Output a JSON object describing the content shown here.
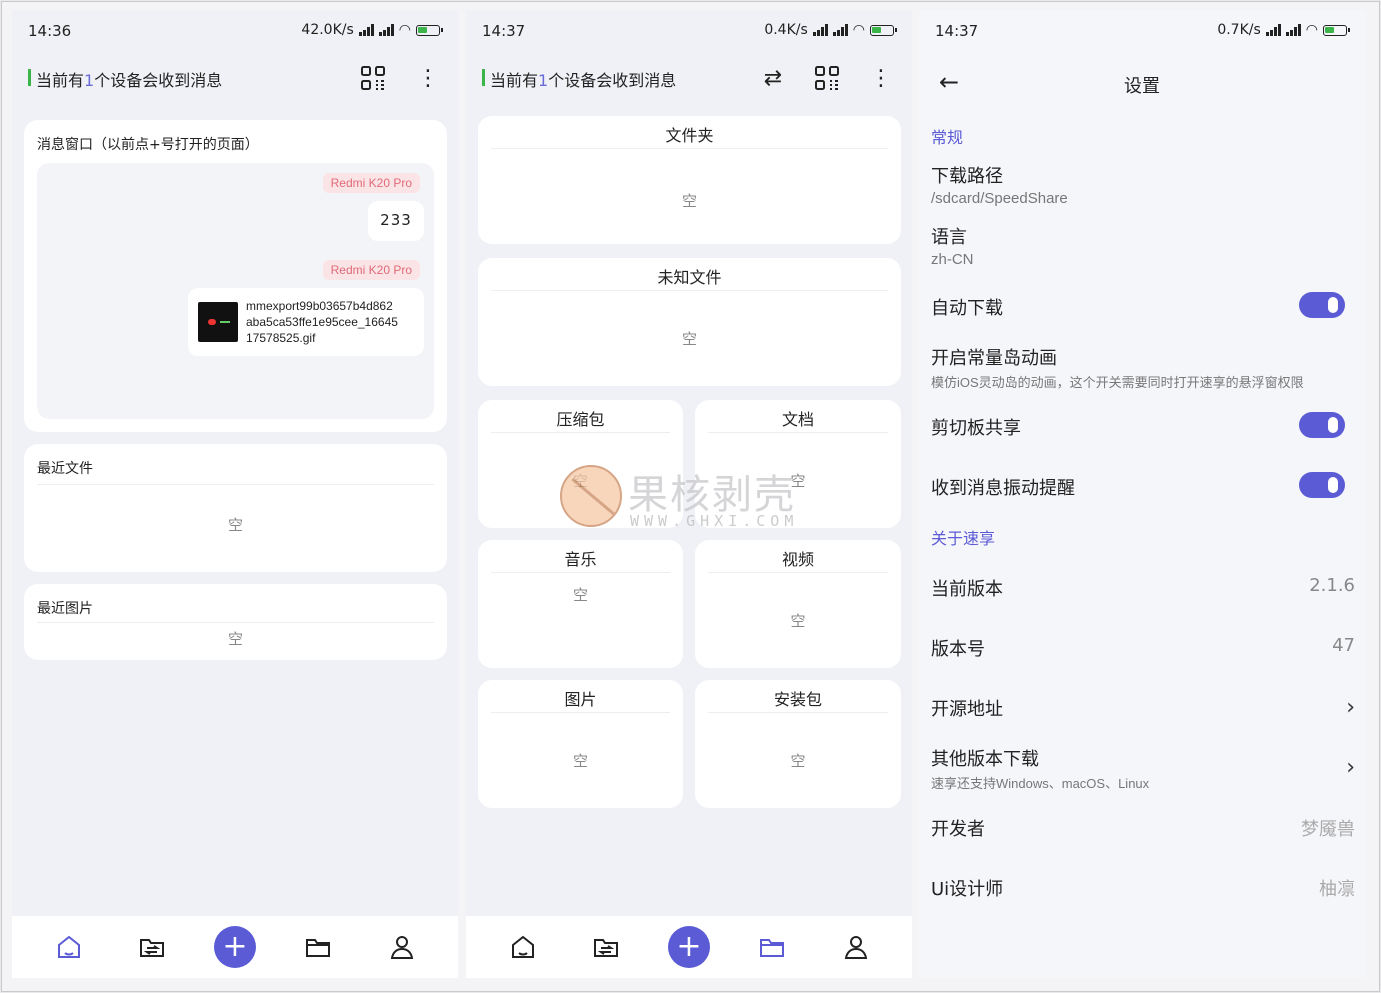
{
  "panel1": {
    "status": {
      "time": "14:36",
      "speed": "42.0K/s"
    },
    "header": {
      "prefix": "当前有",
      "num": "1",
      "suffix": "个设备会收到消息"
    },
    "msg_card": {
      "title": "消息窗口（以前点+号打开的页面）",
      "messages": [
        {
          "device": "Redmi K20 Pro",
          "text": "233"
        },
        {
          "device": "Redmi K20 Pro",
          "file_lines": [
            "mmexport99b03657b4d862",
            "aba5ca53ffe1e95cee_16645",
            "17578525.gif"
          ]
        }
      ]
    },
    "recent_files": {
      "title": "最近文件",
      "empty": "空"
    },
    "recent_images": {
      "title": "最近图片",
      "empty": "空"
    }
  },
  "panel2": {
    "status": {
      "time": "14:37",
      "speed": "0.4K/s"
    },
    "header": {
      "prefix": "当前有",
      "num": "1",
      "suffix": "个设备会收到消息"
    },
    "cards": {
      "folder": {
        "title": "文件夹",
        "empty": "空"
      },
      "unknown": {
        "title": "未知文件",
        "empty": "空"
      },
      "zip": {
        "title": "压缩包",
        "empty": "空"
      },
      "doc": {
        "title": "文档",
        "empty": "空"
      },
      "music": {
        "title": "音乐",
        "empty": "空"
      },
      "video": {
        "title": "视频",
        "empty": "空"
      },
      "image": {
        "title": "图片",
        "empty": "空"
      },
      "apk": {
        "title": "安装包",
        "empty": "空"
      }
    }
  },
  "panel3": {
    "status": {
      "time": "14:37",
      "speed": "0.7K/s"
    },
    "title": "设置",
    "section_general": "常规",
    "download_path": {
      "label": "下载路径",
      "value": "/sdcard/SpeedShare"
    },
    "language": {
      "label": "语言",
      "value": "zh-CN"
    },
    "auto_download": {
      "label": "自动下载",
      "on": true
    },
    "island": {
      "label": "开启常量岛动画",
      "sub": "模仿iOS灵动岛的动画，这个开关需要同时打开速享的悬浮窗权限"
    },
    "clipboard": {
      "label": "剪切板共享",
      "on": true
    },
    "vibrate": {
      "label": "收到消息振动提醒",
      "on": true
    },
    "section_about": "关于速享",
    "version": {
      "label": "当前版本",
      "value": "2.1.6"
    },
    "build": {
      "label": "版本号",
      "value": "47"
    },
    "source": {
      "label": "开源地址"
    },
    "other": {
      "label": "其他版本下载",
      "sub": "速享还支持Windows、macOS、Linux"
    },
    "developer": {
      "label": "开发者",
      "value": "梦魇兽"
    },
    "designer": {
      "label": "Ui设计师",
      "value": "柚凛"
    }
  },
  "watermark": {
    "logo_text": "果核剥壳",
    "url": "WWW.GHXI.COM"
  },
  "colors": {
    "accent": "#5b5bd6",
    "green": "#3bb54a",
    "tag_bg": "#fbe4e6",
    "tag_text": "#e06a78"
  }
}
